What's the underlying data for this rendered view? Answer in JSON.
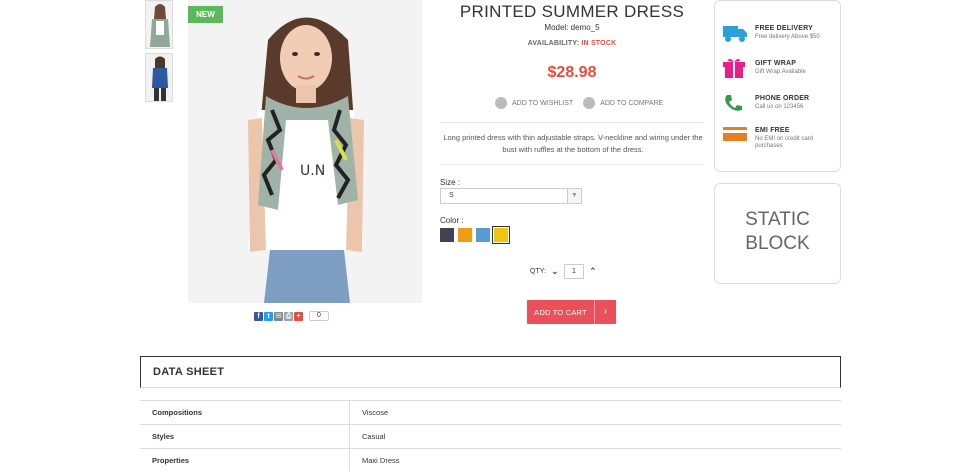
{
  "product": {
    "badge": "NEW",
    "title": "PRINTED SUMMER DRESS",
    "model": "Model: demo_5",
    "availability_label": "AVAILABILITY:",
    "availability_value": "IN STOCK",
    "price": "$28.98",
    "wishlist_label": "ADD TO WISHLIST",
    "compare_label": "ADD TO COMPARE",
    "description": "Long printed dress with thin adjustable straps. V-neckline and wiring under the bust with ruffles at the bottom of the dress.",
    "share_count": "0"
  },
  "options": {
    "size_label": "Size :",
    "size_value": "S",
    "color_label": "Color :",
    "colors": [
      "#3f4450",
      "#f39c12",
      "#5b9bd5",
      "#f1c40f"
    ],
    "selected_color_index": 3
  },
  "quantity": {
    "label": "QTY:",
    "value": "1"
  },
  "cart": {
    "label": "ADD TO CART",
    "arrow": "›"
  },
  "services": [
    {
      "icon": "delivery-truck-icon",
      "title": "FREE DELIVERY",
      "subtitle": "Free delivery Above $50",
      "color": "#2aa1d9"
    },
    {
      "icon": "gift-icon",
      "title": "GIFT WRAP",
      "subtitle": "Gift Wrap Available",
      "color": "#e91e8c"
    },
    {
      "icon": "phone-icon",
      "title": "PHONE ORDER",
      "subtitle": "Call us on 123456",
      "color": "#2e9e46"
    },
    {
      "icon": "credit-card-icon",
      "title": "EMI FREE",
      "subtitle": "No EMI on credit card purchases",
      "color": "#e67e22"
    }
  ],
  "static_block": {
    "line1": "STATIC",
    "line2": "BLOCK"
  },
  "data_sheet": {
    "title": "DATA SHEET",
    "rows": [
      {
        "key": "Compositions",
        "value": "Viscose"
      },
      {
        "key": "Styles",
        "value": "Casual"
      },
      {
        "key": "Properties",
        "value": "Maxi Dress"
      }
    ]
  }
}
